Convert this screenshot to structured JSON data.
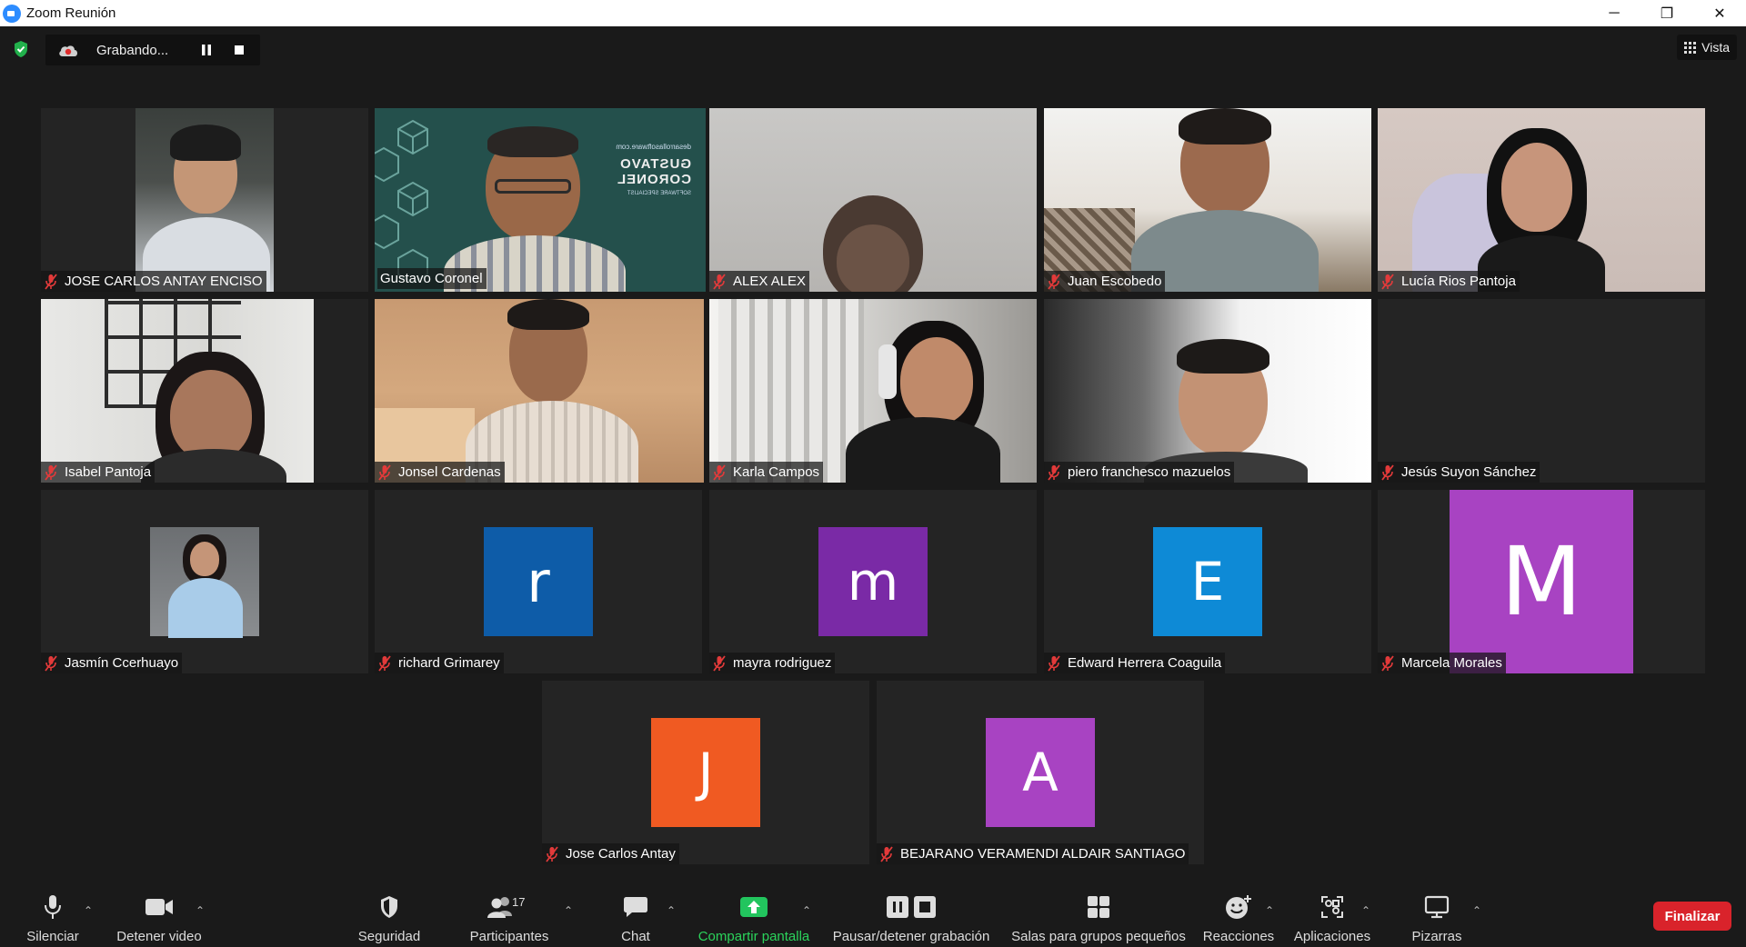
{
  "window": {
    "title": "Zoom Reunión",
    "minimize": "─",
    "restore": "❐",
    "close": "✕"
  },
  "recording": {
    "status": "Grabando..."
  },
  "view": {
    "label": "Vista"
  },
  "participants": [
    {
      "name": "JOSE CARLOS ANTAY ENCISO",
      "video": true,
      "muted": true
    },
    {
      "name": "Gustavo Coronel",
      "video": true,
      "muted": false,
      "active_speaker": true
    },
    {
      "name": "ALEX ALEX",
      "video": true,
      "muted": true
    },
    {
      "name": "Juan Escobedo",
      "video": true,
      "muted": true
    },
    {
      "name": "Lucía Rios Pantoja",
      "video": true,
      "muted": true
    },
    {
      "name": "Isabel Pantoja",
      "video": true,
      "muted": true
    },
    {
      "name": "Jonsel Cardenas",
      "video": true,
      "muted": true
    },
    {
      "name": "Karla Campos",
      "video": true,
      "muted": true
    },
    {
      "name": "piero franchesco mazuelos",
      "video": true,
      "muted": true
    },
    {
      "name": "Jesús Suyon Sánchez",
      "video": false,
      "muted": true
    },
    {
      "name": "Jasmín Ccerhuayo",
      "video": false,
      "muted": true,
      "avatar": "photo"
    },
    {
      "name": "richard Grimarey",
      "video": false,
      "muted": true,
      "avatar_letter": "r",
      "avatar_color": "#0e5ca8"
    },
    {
      "name": "mayra rodriguez",
      "video": false,
      "muted": true,
      "avatar_letter": "m",
      "avatar_color": "#7a2aa6"
    },
    {
      "name": "Edward Herrera Coaguila",
      "video": false,
      "muted": true,
      "avatar_letter": "E",
      "avatar_color": "#0e8ad6"
    },
    {
      "name": "Marcela Morales",
      "video": false,
      "muted": true,
      "avatar_letter": "M",
      "avatar_color": "#a843c2"
    },
    {
      "name": "Jose Carlos Antay",
      "video": false,
      "muted": true,
      "avatar_letter": "J",
      "avatar_color": "#f05a22"
    },
    {
      "name": "BEJARANO VERAMENDI ALDAIR SANTIAGO",
      "video": false,
      "muted": true,
      "avatar_letter": "A",
      "avatar_color": "#a843c2"
    }
  ],
  "background_slide": {
    "name_line1": "GUSTAVO",
    "name_line2": "CORONEL",
    "subtitle": "SOFTWARE SPECIALIST",
    "website": "desarrollasoftware.com"
  },
  "toolbar": {
    "mute": "Silenciar",
    "stop_video": "Detener video",
    "security": "Seguridad",
    "participants": "Participantes",
    "participants_count": "17",
    "chat": "Chat",
    "share_screen": "Compartir pantalla",
    "pause_recording": "Pausar/detener grabación",
    "breakout_rooms": "Salas para grupos pequeños",
    "reactions": "Reacciones",
    "apps": "Aplicaciones",
    "whiteboards": "Pizarras",
    "end": "Finalizar"
  },
  "colors": {
    "active_speaker_border": "#d8e868",
    "share_green": "#2bd35b",
    "end_red": "#d9232b",
    "muted_red": "#e23a3a"
  }
}
